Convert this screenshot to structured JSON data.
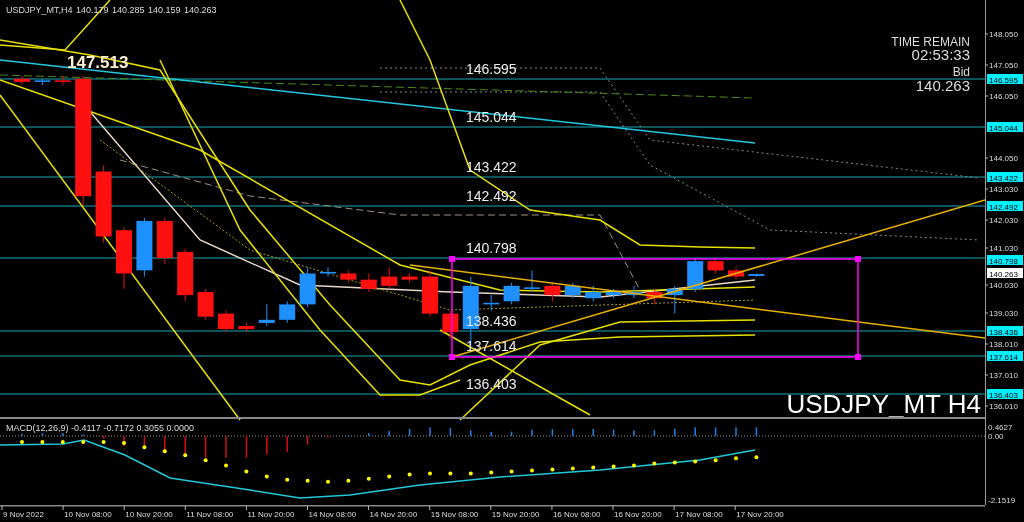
{
  "chart": {
    "symbol": "USDJPY_MT,H4",
    "ohlc": [
      "140.179",
      "140.285",
      "140.159",
      "140.263"
    ],
    "high_label": "147.513",
    "time_remain": {
      "label": "TIME REMAIN",
      "value": "02:53:33"
    },
    "bid": {
      "label": "Bid",
      "value": "140.263"
    },
    "symbol_overlay": "USDJPY_MT H4",
    "levels": [
      {
        "chart_label": "146.595",
        "axis_tag": "146.595"
      },
      {
        "chart_label": "145.044",
        "axis_tag": "145.044"
      },
      {
        "chart_label": "143.422",
        "axis_tag": "143.422"
      },
      {
        "chart_label": "142.492",
        "axis_tag": "142.492"
      },
      {
        "chart_label": "140.798",
        "axis_tag": "140.798"
      },
      {
        "chart_label": "138.436",
        "axis_tag": "138.436"
      },
      {
        "chart_label": "137.614",
        "axis_tag": "137.614"
      },
      {
        "chart_label": "136.403",
        "axis_tag": "136.403"
      }
    ],
    "price_axis": [
      "148.050",
      "147.050",
      "146.050",
      "144.050",
      "143.030",
      "142.030",
      "141.030",
      "140.030",
      "139.030",
      "138.010",
      "137.010",
      "136.010"
    ],
    "bid_tag": "140.263"
  },
  "macd": {
    "label": "MACD(12,26,9) -0.4117 -0.7172 0.3055 0.0000",
    "axis": [
      "0.4627",
      "0.00",
      "-2.1519"
    ]
  },
  "time_axis": [
    "9 Nov 2022",
    "10 Nov 08:00",
    "10 Nov 20:00",
    "11 Nov 08:00",
    "11 Nov 20:00",
    "14 Nov 08:00",
    "14 Nov 20:00",
    "15 Nov 08:00",
    "15 Nov 20:00",
    "16 Nov 08:00",
    "16 Nov 20:00",
    "17 Nov 08:00",
    "17 Nov 20:00"
  ]
}
